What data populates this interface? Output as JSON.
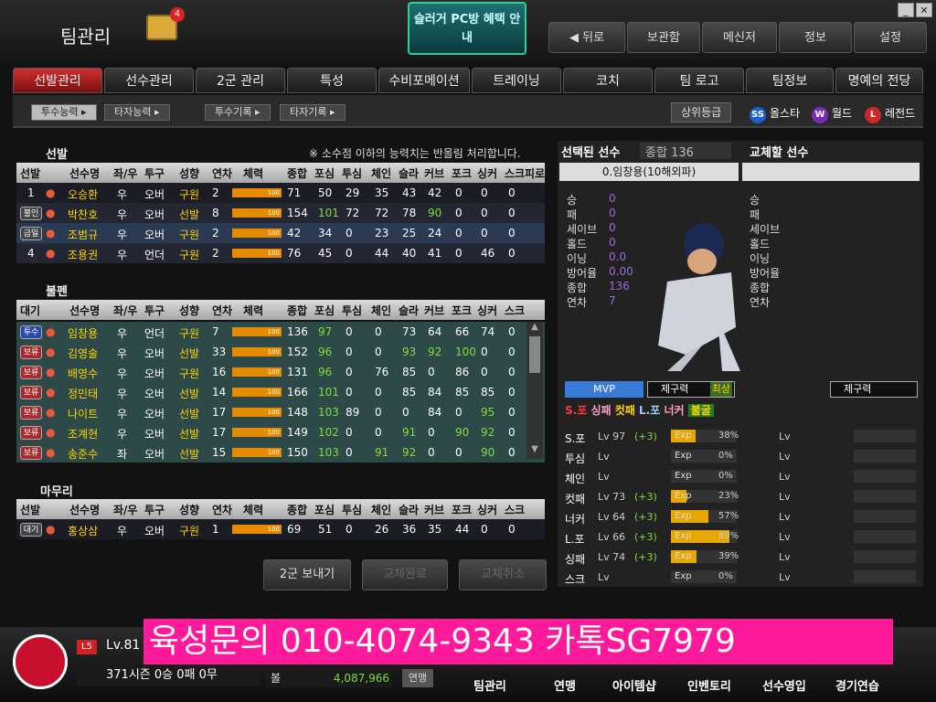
{
  "window": {
    "title": "팀관리",
    "mail_count": "4",
    "pcbang": "슬러거 PC방 혜택 안내",
    "buttons": [
      "뒤로",
      "보관함",
      "메신저",
      "정보",
      "설정"
    ]
  },
  "tabs": [
    "선발관리",
    "선수관리",
    "2군 관리",
    "특성",
    "수비포메이션",
    "트레이닝",
    "코치",
    "팀 로고",
    "팀정보",
    "명예의 전당"
  ],
  "subtabs": [
    "투수능력",
    "타자능력",
    "투수기록",
    "타자기록"
  ],
  "grade_label": "상위등급",
  "legend": [
    {
      "icon": "SS",
      "label": "올스타",
      "color": "#1a5fd0"
    },
    {
      "icon": "W",
      "label": "월드",
      "color": "#7a2ab8"
    },
    {
      "icon": "L",
      "label": "레전드",
      "color": "#d0282a"
    }
  ],
  "starter": {
    "title": "선발",
    "note": "※ 소수점 이하의 능력치는 반올림 처리합니다.",
    "headers": [
      "선발",
      "선수명",
      "좌/우",
      "투구",
      "성향",
      "연차",
      "체력",
      "종합",
      "포심",
      "투심",
      "체인",
      "슬라",
      "커브",
      "포크",
      "싱커",
      "스크",
      "피로"
    ],
    "rows": [
      {
        "slot": "1",
        "name": "오승환",
        "hand": "우",
        "pitch": "오버",
        "style": "구원",
        "year": "2",
        "stamina": "100",
        "ovr": "71",
        "s": [
          "50",
          "29",
          "35",
          "43",
          "42",
          "0",
          "0",
          "0"
        ]
      },
      {
        "slot": "불인",
        "name": "박찬호",
        "hand": "우",
        "pitch": "오버",
        "style": "선발",
        "year": "8",
        "stamina": "100",
        "ovr": "154",
        "s": [
          "101",
          "72",
          "72",
          "78",
          "90",
          "0",
          "0",
          "0"
        ]
      },
      {
        "slot": "금일",
        "name": "조범규",
        "hand": "우",
        "pitch": "오버",
        "style": "구원",
        "year": "2",
        "stamina": "100",
        "ovr": "42",
        "s": [
          "34",
          "0",
          "23",
          "25",
          "24",
          "0",
          "0",
          "0"
        ]
      },
      {
        "slot": "4",
        "name": "조용권",
        "hand": "우",
        "pitch": "언더",
        "style": "구원",
        "year": "2",
        "stamina": "100",
        "ovr": "76",
        "s": [
          "45",
          "0",
          "44",
          "40",
          "41",
          "0",
          "46",
          "0"
        ]
      }
    ]
  },
  "bullpen": {
    "title": "불펜",
    "headers": [
      "대기",
      "선수명",
      "좌/우",
      "투구",
      "성향",
      "연차",
      "체력",
      "종합",
      "포심",
      "투심",
      "체인",
      "슬라",
      "커브",
      "포크",
      "싱커",
      "스크"
    ],
    "rows": [
      {
        "slot": "투수",
        "name": "임창용",
        "hand": "우",
        "pitch": "언더",
        "style": "구원",
        "year": "7",
        "stamina": "100",
        "ovr": "136",
        "s": [
          "97",
          "0",
          "0",
          "73",
          "64",
          "66",
          "74",
          "0"
        ]
      },
      {
        "slot": "보류",
        "name": "김영술",
        "hand": "우",
        "pitch": "오버",
        "style": "선발",
        "year": "33",
        "stamina": "100",
        "ovr": "152",
        "s": [
          "96",
          "0",
          "0",
          "93",
          "92",
          "100",
          "0",
          "0"
        ]
      },
      {
        "slot": "보류",
        "name": "배영수",
        "hand": "우",
        "pitch": "오버",
        "style": "구원",
        "year": "16",
        "stamina": "100",
        "ovr": "131",
        "s": [
          "96",
          "0",
          "76",
          "85",
          "0",
          "86",
          "0",
          "0"
        ]
      },
      {
        "slot": "보류",
        "name": "정민태",
        "hand": "우",
        "pitch": "오버",
        "style": "선발",
        "year": "14",
        "stamina": "100",
        "ovr": "166",
        "s": [
          "101",
          "0",
          "0",
          "85",
          "84",
          "85",
          "85",
          "0"
        ]
      },
      {
        "slot": "보류",
        "name": "나이트",
        "hand": "우",
        "pitch": "오버",
        "style": "선발",
        "year": "17",
        "stamina": "100",
        "ovr": "148",
        "s": [
          "103",
          "89",
          "0",
          "0",
          "84",
          "0",
          "95",
          "0"
        ]
      },
      {
        "slot": "보류",
        "name": "조계현",
        "hand": "우",
        "pitch": "오버",
        "style": "선발",
        "year": "17",
        "stamina": "100",
        "ovr": "149",
        "s": [
          "102",
          "0",
          "0",
          "91",
          "0",
          "90",
          "92",
          "0"
        ]
      },
      {
        "slot": "보류",
        "name": "송준수",
        "hand": "좌",
        "pitch": "오버",
        "style": "선발",
        "year": "15",
        "stamina": "100",
        "ovr": "150",
        "s": [
          "103",
          "0",
          "91",
          "92",
          "0",
          "0",
          "90",
          "0"
        ]
      }
    ]
  },
  "closer": {
    "title": "마무리",
    "headers": [
      "선발",
      "선수명",
      "좌/우",
      "투구",
      "성향",
      "연차",
      "체력",
      "종합",
      "포심",
      "투심",
      "체인",
      "슬라",
      "커브",
      "포크",
      "싱커",
      "스크"
    ],
    "rows": [
      {
        "slot": "대기",
        "name": "홍상삼",
        "hand": "우",
        "pitch": "오버",
        "style": "구원",
        "year": "1",
        "stamina": "100",
        "ovr": "69",
        "s": [
          "51",
          "0",
          "26",
          "36",
          "35",
          "44",
          "0",
          "0"
        ]
      }
    ]
  },
  "actions": [
    "2군 보내기",
    "교체완료",
    "교체취소"
  ],
  "selected": {
    "title": "선택된 선수",
    "ovr_label": "종합",
    "ovr": "136",
    "name": "0.임창용(10해외파)",
    "stats": [
      [
        "승",
        "0"
      ],
      [
        "패",
        "0"
      ],
      [
        "세이브",
        "0"
      ],
      [
        "홀드",
        "0"
      ],
      [
        "이닝",
        "0.0"
      ],
      [
        "방어율",
        "0.00"
      ],
      [
        "종합",
        "136"
      ],
      [
        "연차",
        "7"
      ]
    ],
    "mvp": "MVP",
    "control": "제구력",
    "control_val": "최상",
    "badges": [
      "S.포",
      "싱패",
      "컷패",
      "L.포",
      "너커",
      "불굴"
    ]
  },
  "replace": {
    "title": "교체할 선수",
    "stats": [
      "승",
      "패",
      "세이브",
      "홀드",
      "이닝",
      "방어율",
      "종합",
      "연차"
    ],
    "control": "제구력"
  },
  "skills": [
    {
      "name": "S.포",
      "lv": "97",
      "plus": "(+3)",
      "exp": "38%"
    },
    {
      "name": "투심",
      "lv": "",
      "plus": "",
      "exp": "0%"
    },
    {
      "name": "체인",
      "lv": "",
      "plus": "",
      "exp": "0%"
    },
    {
      "name": "컷패",
      "lv": "73",
      "plus": "(+3)",
      "exp": "23%"
    },
    {
      "name": "너커",
      "lv": "64",
      "plus": "(+3)",
      "exp": "57%"
    },
    {
      "name": "L.포",
      "lv": "66",
      "plus": "(+3)",
      "exp": "89%"
    },
    {
      "name": "싱패",
      "lv": "74",
      "plus": "(+3)",
      "exp": "39%"
    },
    {
      "name": "스크",
      "lv": "",
      "plus": "",
      "exp": "0%"
    }
  ],
  "footer": {
    "level_badge": "L5",
    "level": "Lv.81",
    "season": "371시즌 0승 0패 0무",
    "money_label": "볼",
    "money": "4,087,966",
    "league": "연맹",
    "nav": [
      "팀관리",
      "연맹",
      "아이템샵",
      "인벤토리",
      "선수영입",
      "경기연습"
    ]
  },
  "promo": "육성문의 010-4074-9343 카톡SG7979"
}
